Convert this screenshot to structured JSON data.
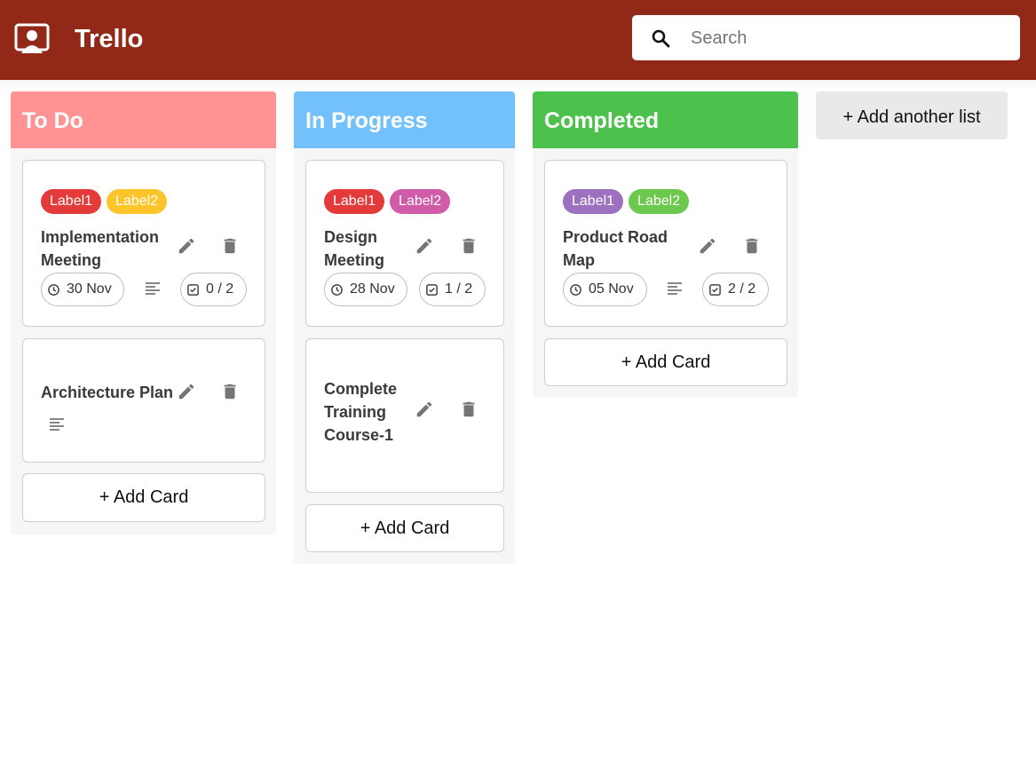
{
  "app": {
    "title": "Trello"
  },
  "search": {
    "placeholder": "Search",
    "value": ""
  },
  "colors": {
    "header": "#922918",
    "todo": "#ff9393",
    "in_progress": "#73c1fa",
    "completed": "#4cc14b",
    "label_red": "#e53a3a",
    "label_yellow": "#fdc529",
    "label_pink": "#d05ba8",
    "label_purple": "#9e70c0",
    "label_green": "#6cc94d"
  },
  "icons": {
    "logo": "presentation-user-icon",
    "search": "search-icon",
    "edit": "pencil-icon",
    "delete": "trash-icon",
    "due": "clock-icon",
    "description": "text-lines-icon",
    "checklist": "checkbox-icon"
  },
  "lists": [
    {
      "title": "To Do",
      "cards": [
        {
          "labels": [
            "Label1",
            "Label2"
          ],
          "title": "Implementation Meeting",
          "due": "30 Nov",
          "checklist": "0 / 2"
        },
        {
          "title": "Architecture Plan"
        }
      ],
      "add_card": "+ Add Card"
    },
    {
      "title": "In Progress",
      "cards": [
        {
          "labels": [
            "Label1",
            "Label2"
          ],
          "title": "Design Meeting",
          "due": "28 Nov",
          "checklist": "1 / 2"
        },
        {
          "title": "Complete Training Course-1"
        }
      ],
      "add_card": "+ Add Card"
    },
    {
      "title": "Completed",
      "cards": [
        {
          "labels": [
            "Label1",
            "Label2"
          ],
          "title": "Product Road Map",
          "due": "05 Nov",
          "checklist": "2 / 2"
        }
      ],
      "add_card": "+ Add Card"
    }
  ],
  "add_list": "+ Add another list"
}
